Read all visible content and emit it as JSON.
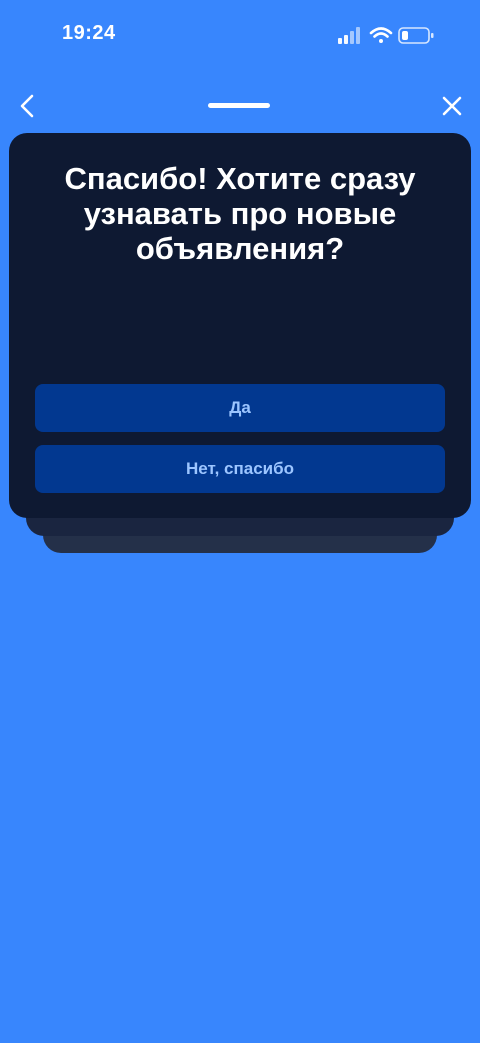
{
  "status_bar": {
    "time": "19:24",
    "icons": [
      "cellular-signal-icon",
      "wifi-icon",
      "battery-icon"
    ]
  },
  "nav": {
    "back_icon": "chevron-left-icon",
    "close_icon": "close-icon"
  },
  "dialog": {
    "title": "Спасибо! Хотите сразу узнавать про новые объявления?",
    "yes_label": "Да",
    "no_label": "Нет, спасибо"
  },
  "colors": {
    "background": "#3886fd",
    "card": "#0e1932",
    "button": "#023890",
    "button_text": "#9cc5ff"
  }
}
